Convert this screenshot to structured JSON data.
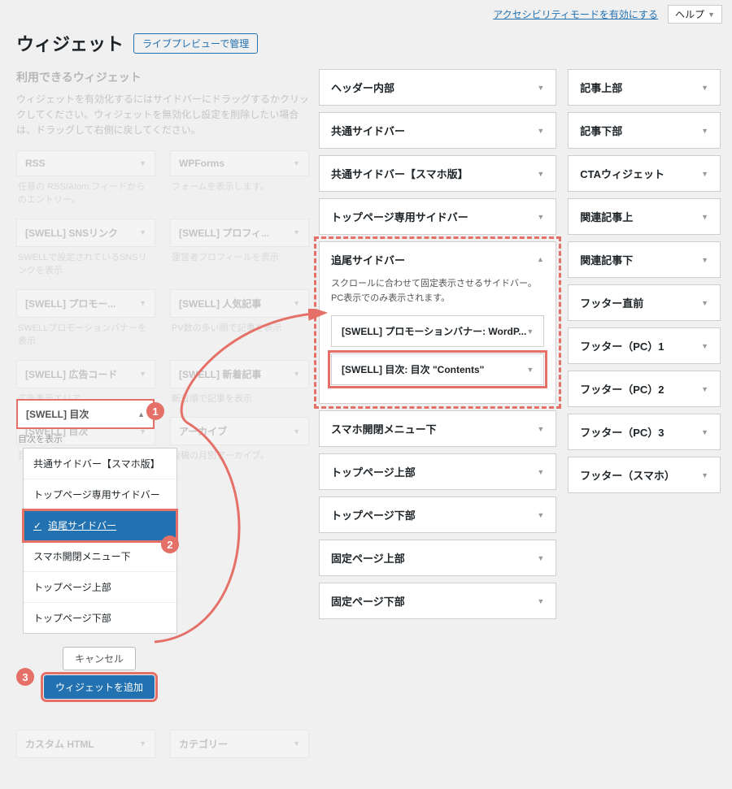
{
  "topbar": {
    "a11y_link": "アクセシビリティモードを有効にする",
    "help": "ヘルプ"
  },
  "header": {
    "title": "ウィジェット",
    "live_preview": "ライブプレビューで管理"
  },
  "left": {
    "heading": "利用できるウィジェット",
    "description": "ウィジェットを有効化するにはサイドバーにドラッグするかクリックしてください。ウィジェットを無効化し設定を削除したい場合は、ドラッグして右側に戻してください。",
    "items": [
      {
        "title": "RSS",
        "sub": "任意の RSS/Atom フィードからのエントリー。"
      },
      {
        "title": "WPForms",
        "sub": "フォームを表示します。"
      },
      {
        "title": "[SWELL] SNSリンク",
        "sub": "SWELLで設定されているSNSリンクを表示"
      },
      {
        "title": "[SWELL] プロフィ...",
        "sub": "運営者プロフィールを表示"
      },
      {
        "title": "[SWELL] プロモー...",
        "sub": "SWELLプロモーションバナーを表示"
      },
      {
        "title": "[SWELL] 人気記事",
        "sub": "PV数の多い順で記事を表示"
      },
      {
        "title": "[SWELL] 広告コード",
        "sub": "広告表示エリア"
      },
      {
        "title": "[SWELL] 新着記事",
        "sub": "新着順で記事を表示"
      },
      {
        "title": "[SWELL] 目次",
        "sub": "目次を表示"
      },
      {
        "title": "アーカイブ",
        "sub": "投稿の月別アーカイブ。"
      },
      {
        "title": "カスタム HTML",
        "sub": ""
      },
      {
        "title": "カテゴリー",
        "sub": ""
      }
    ],
    "open_index": 8,
    "area_options": [
      "共通サイドバー【スマホ版】",
      "トップページ専用サイドバー",
      "追尾サイドバー",
      "スマホ開閉メニュー下",
      "トップページ上部",
      "トップページ下部"
    ],
    "selected_area_index": 2,
    "cancel": "キャンセル",
    "add": "ウィジェットを追加"
  },
  "areas_mid": [
    {
      "label": "ヘッダー内部"
    },
    {
      "label": "共通サイドバー"
    },
    {
      "label": "共通サイドバー【スマホ版】"
    },
    {
      "label": "トップページ専用サイドバー"
    },
    {
      "label": "追尾サイドバー",
      "open": true,
      "hint": "スクロールに合わせて固定表示させるサイドバー。PC表示でのみ表示されます。",
      "inner": [
        "[SWELL] プロモーションバナー: WordP...",
        "[SWELL] 目次: 目次 \"Contents\""
      ]
    },
    {
      "label": "スマホ開閉メニュー下"
    },
    {
      "label": "トップページ上部"
    },
    {
      "label": "トップページ下部"
    },
    {
      "label": "固定ページ上部"
    },
    {
      "label": "固定ページ下部"
    }
  ],
  "areas_right": [
    {
      "label": "記事上部"
    },
    {
      "label": "記事下部"
    },
    {
      "label": "CTAウィジェット"
    },
    {
      "label": "関連記事上"
    },
    {
      "label": "関連記事下"
    },
    {
      "label": "フッター直前"
    },
    {
      "label": "フッター（PC）1"
    },
    {
      "label": "フッター（PC）2"
    },
    {
      "label": "フッター（PC）3"
    },
    {
      "label": "フッター（スマホ）"
    }
  ],
  "badges": {
    "b1": "1",
    "b2": "2",
    "b3": "3"
  }
}
